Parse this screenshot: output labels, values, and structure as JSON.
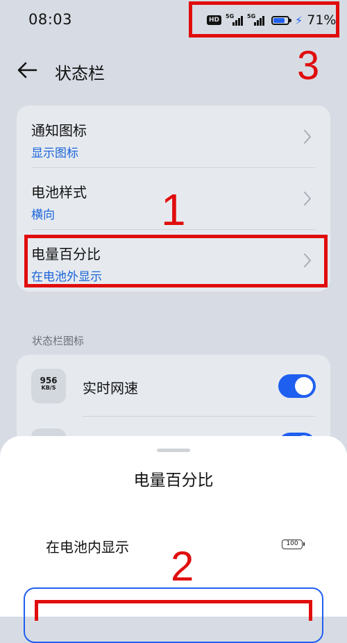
{
  "status_bar": {
    "time": "08:03",
    "hd_label": "HD",
    "sim1_label": "5G",
    "sim2_label": "5G",
    "battery_level": 0.71,
    "battery_percent": "71%",
    "accent_color": "#1f5ff0"
  },
  "header": {
    "back_icon": "arrow-left-icon",
    "title": "状态栏"
  },
  "settings": {
    "notification_icons": {
      "title": "通知图标",
      "value": "显示图标"
    },
    "battery_style": {
      "title": "电池样式",
      "value": "横向"
    },
    "battery_percentage": {
      "title": "电量百分比",
      "value": "在电池外显示"
    }
  },
  "statusbar_icons": {
    "section_title": "状态栏图标",
    "realtime_speed": {
      "icon_number": "956",
      "icon_unit": "KB/S",
      "label": "实时网速",
      "enabled": true
    },
    "second_toggle_enabled": true
  },
  "sheet": {
    "title": "电量百分比",
    "option_inside": {
      "label": "在电池内显示",
      "preview": "100"
    }
  },
  "annotations": {
    "label_1": "1",
    "label_2": "2",
    "label_3": "3",
    "color": "#e00d0d"
  }
}
